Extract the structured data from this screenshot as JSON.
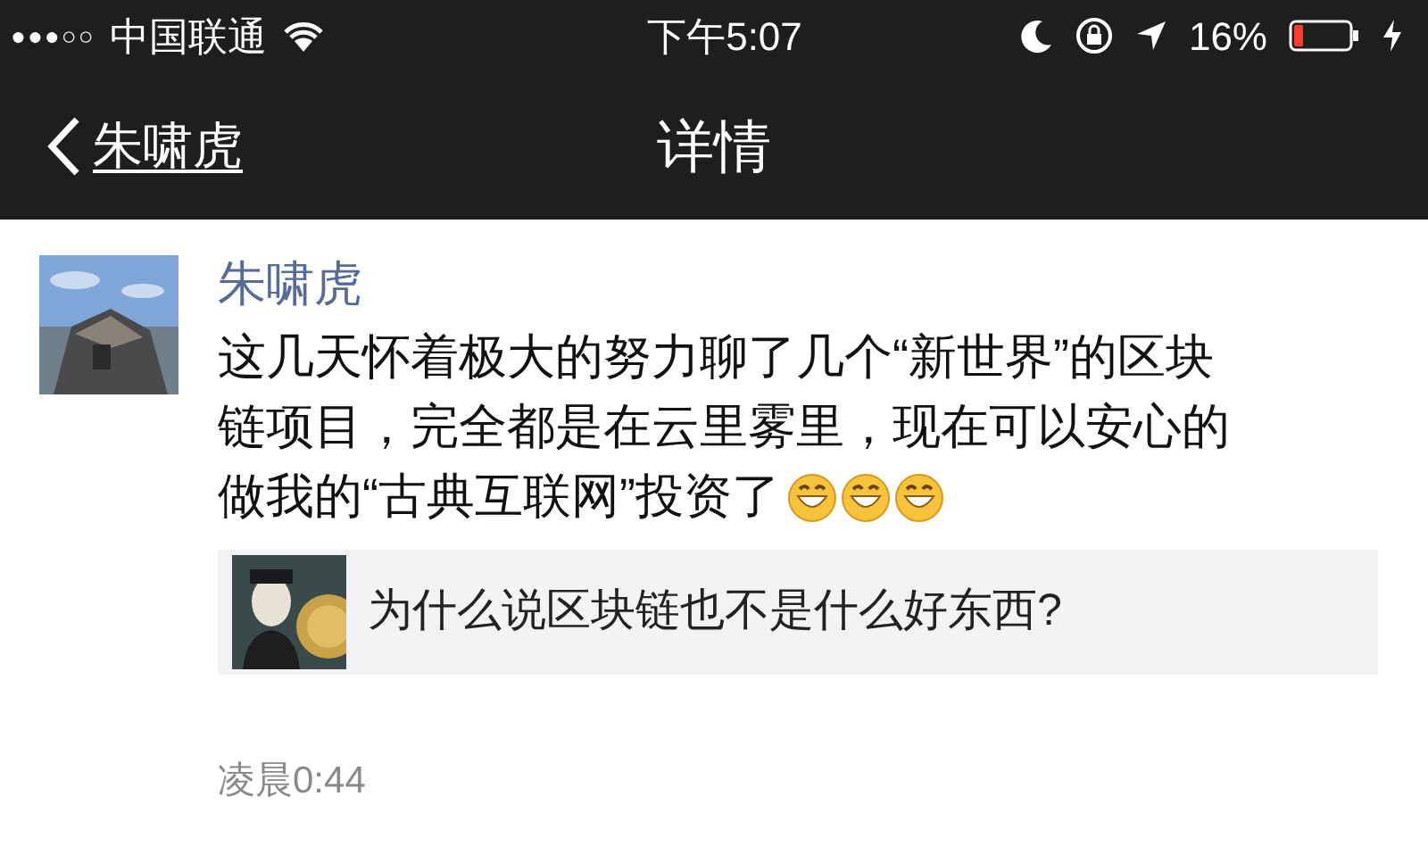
{
  "status_bar": {
    "signal": "●●●○○",
    "carrier": "中国联通",
    "time": "下午5:07",
    "battery_percent": "16%"
  },
  "nav_bar": {
    "back_label": "朱啸虎",
    "title": "详情"
  },
  "post": {
    "author": "朱啸虎",
    "text_lines": [
      "这几天怀着极大的努力聊了几个“新世界”的区块",
      "链项目，完全都是在云里雾里，现在可以安心的",
      "做我的“古典互联网”投资了"
    ],
    "link_card": {
      "title": "为什么说区块链也不是什么好东西?"
    },
    "time": "凌晨0:44"
  }
}
